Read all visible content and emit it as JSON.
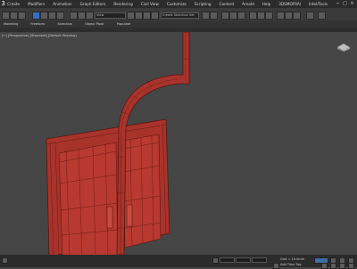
{
  "app": {
    "menus": [
      "Create",
      "Modifiers",
      "Animation",
      "Graph Editors",
      "Rendering",
      "Civil View",
      "Customize",
      "Scripting",
      "Content",
      "Arnold",
      "Help",
      "3DSMOFRAI",
      "Intel/Tools"
    ],
    "window_controls": [
      "−",
      "□",
      "×"
    ]
  },
  "toolbar": {
    "selection_set_label": "Create Selection Set",
    "view_label": "View"
  },
  "ribbon": {
    "tabs": [
      "Modeling",
      "Freeform",
      "Selection",
      "Object Paint",
      "Populate"
    ]
  },
  "viewport": {
    "label": "[+] [Perspective] [Standard] [Default Shading]",
    "colors": {
      "model_fill": "#a8332b",
      "wire": "#5a1512",
      "background": "#454545"
    }
  },
  "statusbar": {
    "grid_label": "Grid = 10.0mm",
    "add_time_tag": "Add Time Tag",
    "auto_key": "Auto Key",
    "set_key": "Set Key"
  }
}
